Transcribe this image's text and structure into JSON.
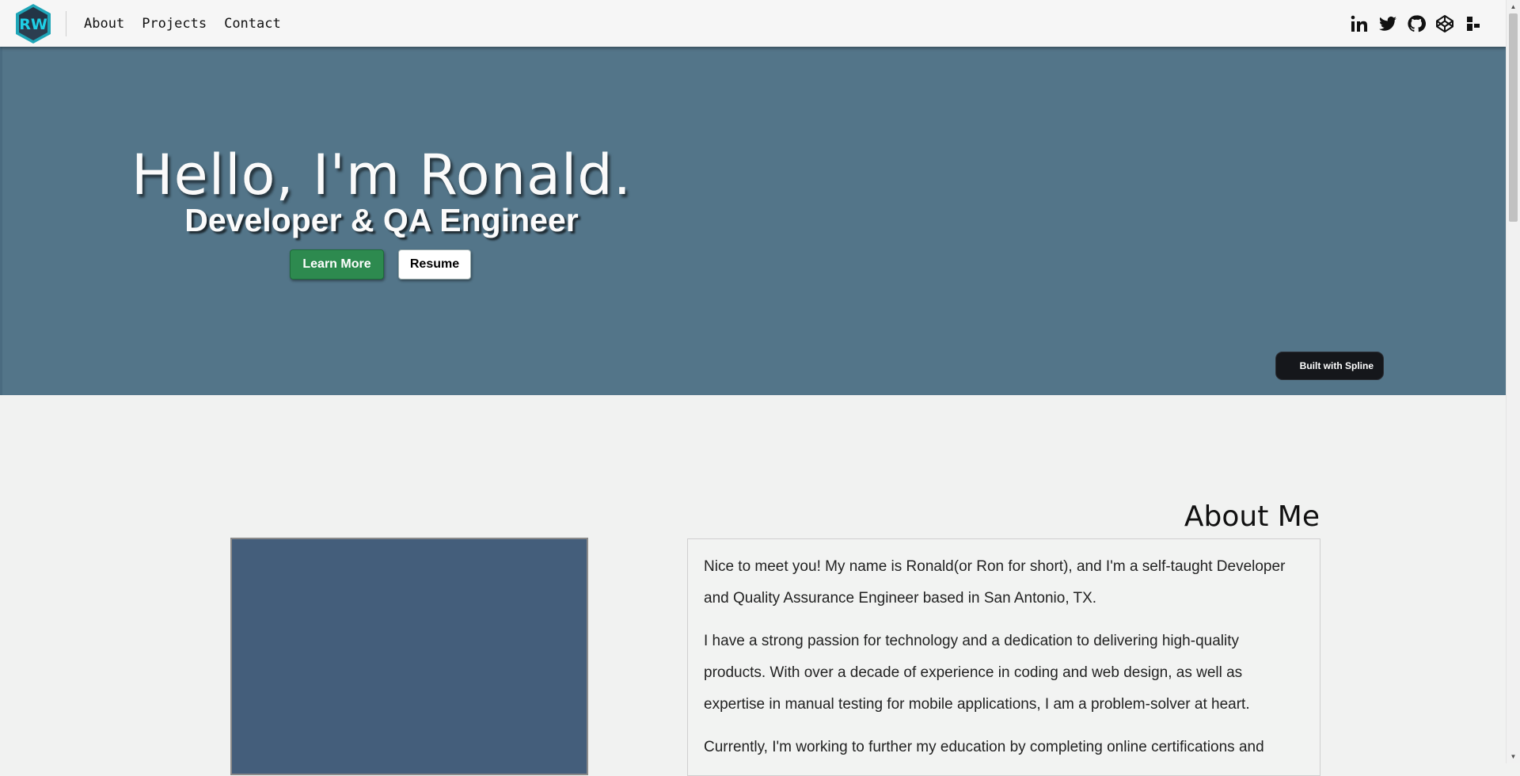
{
  "navbar": {
    "logo_text": "RW",
    "links": [
      "About",
      "Projects",
      "Contact"
    ],
    "social_icons": [
      "linkedin-icon",
      "twitter-icon",
      "github-icon",
      "codepen-icon",
      "fiverr-icon"
    ]
  },
  "hero": {
    "title": "Hello, I'm Ronald.",
    "subtitle": "Developer & QA Engineer",
    "primary_button": "Learn More",
    "secondary_button": "Resume",
    "badge": "Built with Spline",
    "background_color": "#537589"
  },
  "about": {
    "heading": "About Me",
    "paragraphs": [
      "Nice to meet you! My name is Ronald(or Ron for short), and I'm a self-taught Developer and Quality Assurance Engineer based in San Antonio, TX.",
      "I have a strong passion for technology and a dedication to delivering high-quality products. With over a decade of experience in coding and web design, as well as expertise in manual testing for mobile applications, I am a problem-solver at heart.",
      "Currently, I'm working to further my education by completing online certifications and"
    ]
  },
  "colors": {
    "accent_green": "#2d8a4f",
    "hero_blue": "#537589",
    "photo_placeholder": "#445e7b"
  }
}
